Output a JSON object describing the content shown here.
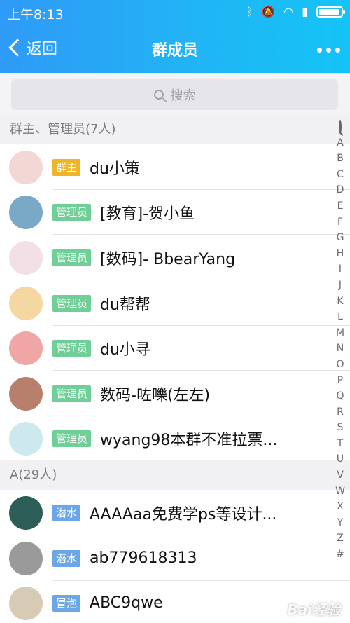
{
  "status_bar": {
    "time": "上午8:13",
    "icons": [
      "bluetooth-icon",
      "mute-icon",
      "wifi-icon",
      "signal-icon",
      "battery-icon"
    ]
  },
  "navbar": {
    "back_label": "返回",
    "title": "群成员",
    "more_icon": "more-icon"
  },
  "search": {
    "placeholder": "搜索"
  },
  "sections": [
    {
      "label": "群主、管理员(7人)"
    },
    {
      "label": "A(29人)"
    }
  ],
  "members": [
    {
      "badge": "群主",
      "badge_color": "#f0b429",
      "name": "du小策",
      "avatar_color": "#f2d7d5"
    },
    {
      "badge": "管理员",
      "badge_color": "#6fcf97",
      "name": "[教育]-贺小鱼",
      "avatar_color": "#7aa9c8"
    },
    {
      "badge": "管理员",
      "badge_color": "#6fcf97",
      "name": "[数码]-   BbearYang",
      "avatar_color": "#f3e0e6"
    },
    {
      "badge": "管理员",
      "badge_color": "#6fcf97",
      "name": "du帮帮",
      "avatar_color": "#f5d7a1"
    },
    {
      "badge": "管理员",
      "badge_color": "#6fcf97",
      "name": "du小寻",
      "avatar_color": "#f1a6a6"
    },
    {
      "badge": "管理员",
      "badge_color": "#6fcf97",
      "name": "数码-咗嚛(左左)",
      "avatar_color": "#b87f6d"
    },
    {
      "badge": "管理员",
      "badge_color": "#6fcf97",
      "name": "wyang98本群不准拉票...",
      "avatar_color": "#cde9ef"
    },
    {
      "badge": "潜水",
      "badge_color": "#6aa6e8",
      "name": "AAAAaa免费学ps等设计...",
      "avatar_color": "#2c5d57"
    },
    {
      "badge": "潜水",
      "badge_color": "#6aa6e8",
      "name": "ab779618313",
      "avatar_color": "#9a9a9a"
    },
    {
      "badge": "冒泡",
      "badge_color": "#6aa6e8",
      "name": "ABC9qwe",
      "avatar_color": "#d8cbb5"
    }
  ],
  "index_letters": [
    "A",
    "B",
    "C",
    "D",
    "E",
    "F",
    "G",
    "H",
    "I",
    "J",
    "K",
    "L",
    "M",
    "N",
    "O",
    "P",
    "Q",
    "R",
    "S",
    "T",
    "U",
    "V",
    "W",
    "X",
    "Y",
    "Z",
    "#"
  ],
  "watermark": "Bai经验"
}
